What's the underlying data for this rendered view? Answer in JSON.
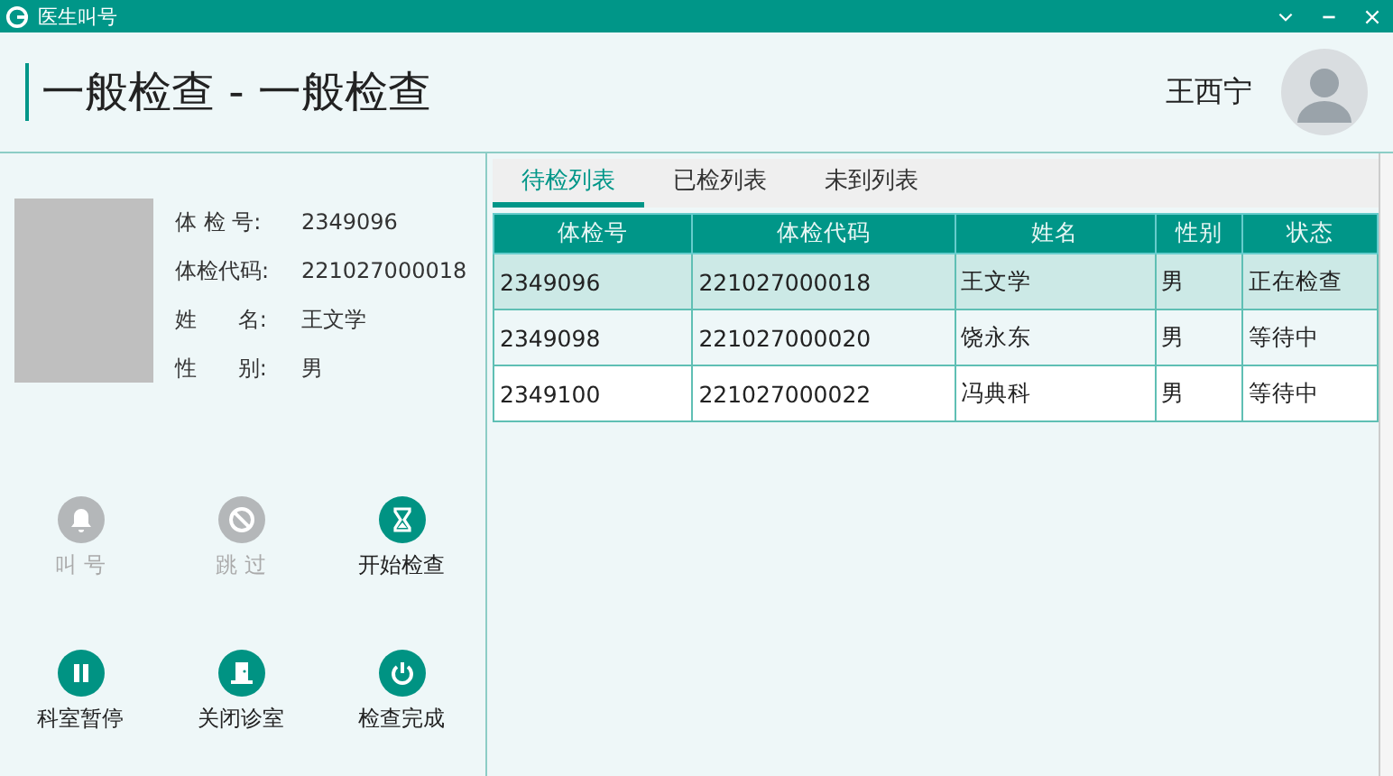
{
  "window": {
    "title": "医生叫号"
  },
  "header": {
    "title": "一般检查 - 一般检查",
    "user": "王西宁"
  },
  "patient": {
    "fields": [
      {
        "label": "体 检 号:",
        "value": "2349096"
      },
      {
        "label": "体检代码:",
        "value": "221027000018"
      },
      {
        "label": "姓      名:",
        "value": "王文学"
      },
      {
        "label": "性      别:",
        "value": "男"
      }
    ]
  },
  "actions": [
    {
      "kind": "bell",
      "label": "叫 号",
      "disabled": true
    },
    {
      "kind": "block",
      "label": "跳 过",
      "disabled": true
    },
    {
      "kind": "hourglass",
      "label": "开始检查",
      "disabled": false
    },
    {
      "kind": "pause",
      "label": "科室暂停",
      "disabled": false
    },
    {
      "kind": "door",
      "label": "关闭诊室",
      "disabled": false
    },
    {
      "kind": "power",
      "label": "检查完成",
      "disabled": false
    }
  ],
  "tabs": [
    {
      "label": "待检列表",
      "selected": true
    },
    {
      "label": "已检列表",
      "selected": false
    },
    {
      "label": "未到列表",
      "selected": false
    }
  ],
  "table": {
    "columns": [
      "体检号",
      "体检代码",
      "姓名",
      "性别",
      "状态"
    ],
    "rows": [
      {
        "cells": [
          "2349096",
          "221027000018",
          "王文学",
          "男",
          "正在检查"
        ],
        "selected": true
      },
      {
        "cells": [
          "2349098",
          "221027000020",
          "饶永东",
          "男",
          "等待中"
        ],
        "selected": false
      },
      {
        "cells": [
          "2349100",
          "221027000022",
          "冯典科",
          "男",
          "等待中"
        ],
        "selected": false
      }
    ]
  }
}
